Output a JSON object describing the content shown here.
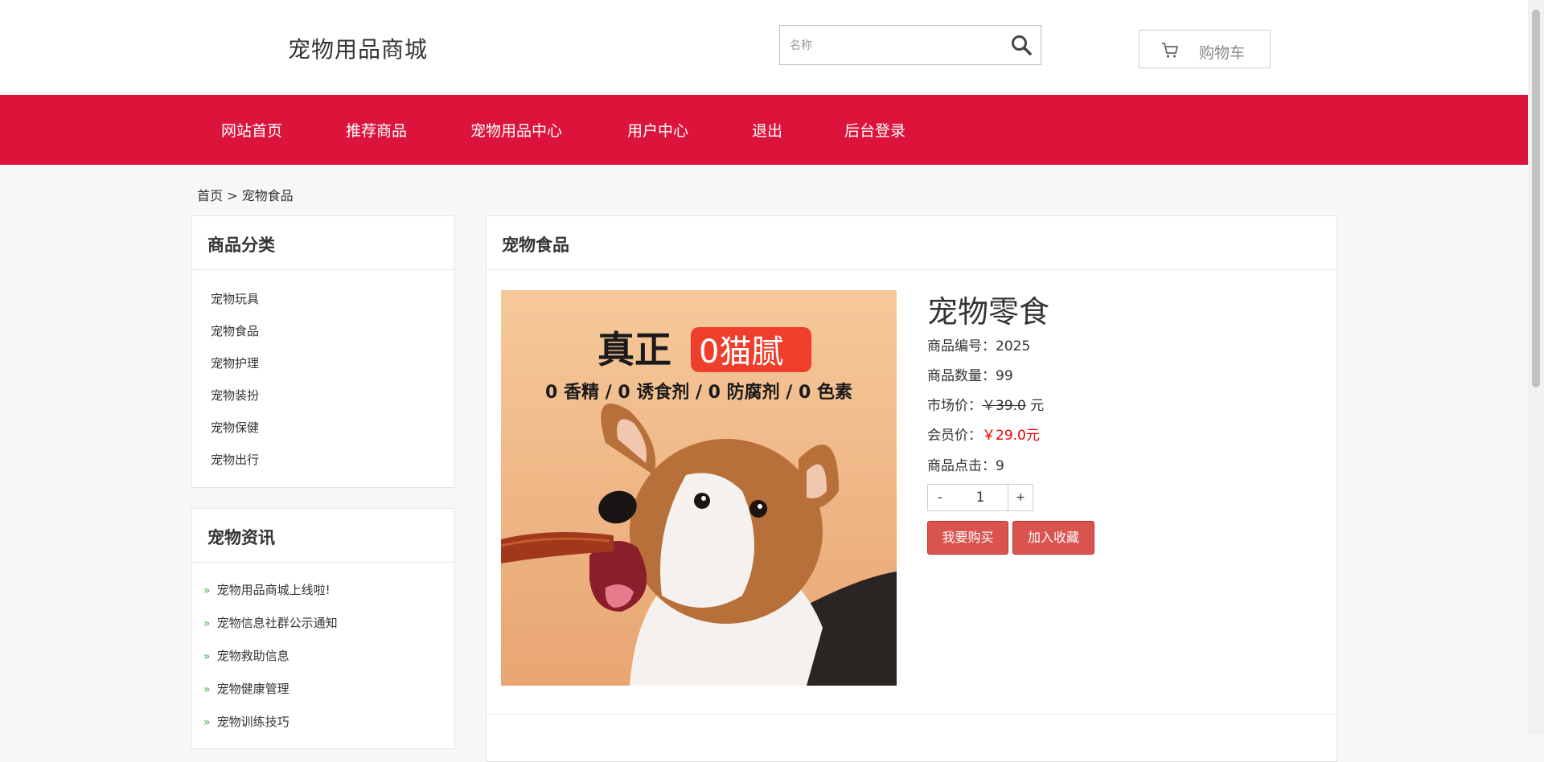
{
  "header": {
    "site_title": "宠物用品商城",
    "search_placeholder": "名称",
    "cart_label": "购物车"
  },
  "nav": {
    "items": [
      {
        "label": "网站首页"
      },
      {
        "label": "推荐商品"
      },
      {
        "label": "宠物用品中心"
      },
      {
        "label": "用户中心"
      },
      {
        "label": "退出"
      },
      {
        "label": "后台登录"
      }
    ]
  },
  "breadcrumb": "首页 > 宠物食品",
  "sidebar": {
    "categories": {
      "title": "商品分类",
      "items": [
        "宠物玩具",
        "宠物食品",
        "宠物护理",
        "宠物装扮",
        "宠物保健",
        "宠物出行"
      ]
    },
    "news": {
      "title": "宠物资讯",
      "items": [
        "宠物用品商城上线啦!",
        "宠物信息社群公示通知",
        "宠物救助信息",
        "宠物健康管理",
        "宠物训练技巧"
      ]
    }
  },
  "main": {
    "section_title": "宠物食品",
    "product": {
      "name": "宠物零食",
      "code_label": "商品编号：",
      "code": "2025",
      "quantity_label": "商品数量：",
      "quantity": "99",
      "market_price_label": "市场价：",
      "market_price": "￥39.0",
      "market_price_unit": " 元",
      "member_price_label": "会员价：",
      "member_price": "￥29.0元",
      "clicks_label": "商品点击：",
      "clicks": "9",
      "qty_value": "1",
      "qty_minus": "-",
      "qty_plus": "+",
      "buy_button": "我要购买",
      "favorite_button": "加入收藏",
      "image": {
        "headline_part1": "真正",
        "headline_badge": "0猫腻",
        "subline": "0 香精 / 0 诱食剂 / 0 防腐剂 / 0 色素"
      }
    }
  },
  "colors": {
    "brand_red": "#dc143c",
    "button_red": "#d9534f",
    "price_red": "#ee0000",
    "bullet_green": "#4caf50"
  }
}
